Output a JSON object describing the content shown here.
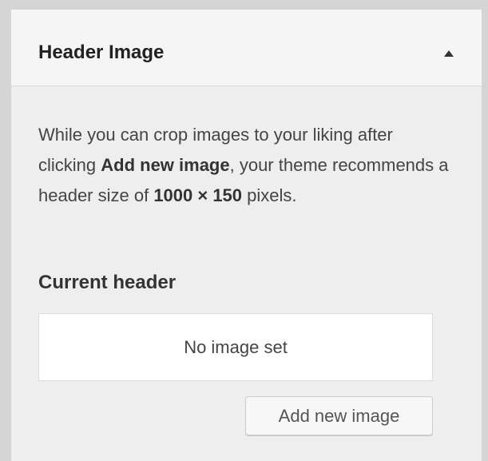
{
  "section": {
    "title": "Header Image",
    "toggle_icon": "triangle-up-icon"
  },
  "description": {
    "part1": "While you can crop images to your liking after clicking ",
    "button_name": "Add new image",
    "part2": ", your theme recommends a header size of ",
    "size": "1000 × 150",
    "part3": " pixels."
  },
  "current_header": {
    "label": "Current header",
    "empty_text": "No image set"
  },
  "actions": {
    "add_new_image_label": "Add new image"
  },
  "colors": {
    "background": "#d5d5d5",
    "panel_header": "#f5f5f5",
    "panel_body": "#eeeeee",
    "box_bg": "#ffffff",
    "text": "#444444"
  }
}
